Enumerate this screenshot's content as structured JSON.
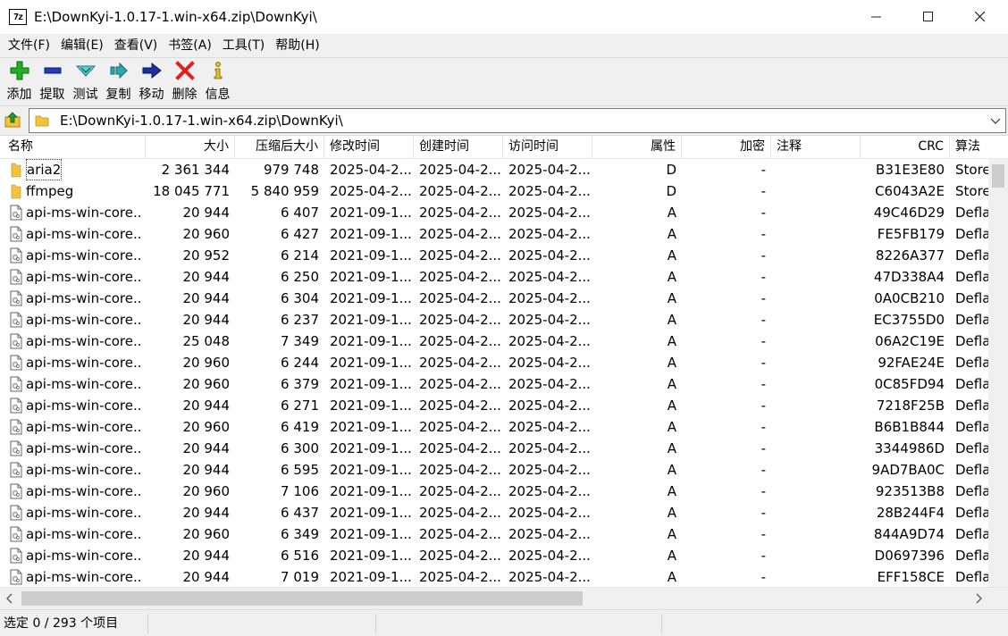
{
  "window": {
    "app_icon_text": "7z",
    "title": "E:\\DownKyi-1.0.17-1.win-x64.zip\\DownKyi\\"
  },
  "menu": [
    "文件(F)",
    "编辑(E)",
    "查看(V)",
    "书签(A)",
    "工具(T)",
    "帮助(H)"
  ],
  "toolbar": [
    {
      "label": "添加",
      "icon": "add-icon"
    },
    {
      "label": "提取",
      "icon": "extract-icon"
    },
    {
      "label": "测试",
      "icon": "test-icon"
    },
    {
      "label": "复制",
      "icon": "copy-icon"
    },
    {
      "label": "移动",
      "icon": "move-icon"
    },
    {
      "label": "删除",
      "icon": "delete-icon"
    },
    {
      "label": "信息",
      "icon": "info-icon"
    }
  ],
  "address": {
    "path": "E:\\DownKyi-1.0.17-1.win-x64.zip\\DownKyi\\"
  },
  "columns": [
    "名称",
    "大小",
    "压缩后大小",
    "修改时间",
    "创建时间",
    "访问时间",
    "属性",
    "加密",
    "注释",
    "CRC",
    "算法"
  ],
  "rows": [
    {
      "name": "aria2",
      "type": "folder",
      "size": "2 361 344",
      "packed": "979 748",
      "modified": "2025-04-2...",
      "created": "2025-04-2...",
      "accessed": "2025-04-2...",
      "attr": "D",
      "enc": "-",
      "comment": "",
      "crc": "B31E3E80",
      "method": "Store"
    },
    {
      "name": "ffmpeg",
      "type": "folder",
      "size": "18 045 771",
      "packed": "5 840 959",
      "modified": "2025-04-2...",
      "created": "2025-04-2...",
      "accessed": "2025-04-2...",
      "attr": "D",
      "enc": "-",
      "comment": "",
      "crc": "C6043A2E",
      "method": "Store"
    },
    {
      "name": "api-ms-win-core...",
      "type": "file",
      "size": "20 944",
      "packed": "6 407",
      "modified": "2021-09-1...",
      "created": "2025-04-2...",
      "accessed": "2025-04-2...",
      "attr": "A",
      "enc": "-",
      "comment": "",
      "crc": "49C46D29",
      "method": "Defla"
    },
    {
      "name": "api-ms-win-core...",
      "type": "file",
      "size": "20 960",
      "packed": "6 427",
      "modified": "2021-09-1...",
      "created": "2025-04-2...",
      "accessed": "2025-04-2...",
      "attr": "A",
      "enc": "-",
      "comment": "",
      "crc": "FE5FB179",
      "method": "Defla"
    },
    {
      "name": "api-ms-win-core...",
      "type": "file",
      "size": "20 952",
      "packed": "6 214",
      "modified": "2021-09-1...",
      "created": "2025-04-2...",
      "accessed": "2025-04-2...",
      "attr": "A",
      "enc": "-",
      "comment": "",
      "crc": "8226A377",
      "method": "Defla"
    },
    {
      "name": "api-ms-win-core...",
      "type": "file",
      "size": "20 944",
      "packed": "6 250",
      "modified": "2021-09-1...",
      "created": "2025-04-2...",
      "accessed": "2025-04-2...",
      "attr": "A",
      "enc": "-",
      "comment": "",
      "crc": "47D338A4",
      "method": "Defla"
    },
    {
      "name": "api-ms-win-core...",
      "type": "file",
      "size": "20 944",
      "packed": "6 304",
      "modified": "2021-09-1...",
      "created": "2025-04-2...",
      "accessed": "2025-04-2...",
      "attr": "A",
      "enc": "-",
      "comment": "",
      "crc": "0A0CB210",
      "method": "Defla"
    },
    {
      "name": "api-ms-win-core...",
      "type": "file",
      "size": "20 944",
      "packed": "6 237",
      "modified": "2021-09-1...",
      "created": "2025-04-2...",
      "accessed": "2025-04-2...",
      "attr": "A",
      "enc": "-",
      "comment": "",
      "crc": "EC3755D0",
      "method": "Defla"
    },
    {
      "name": "api-ms-win-core...",
      "type": "file",
      "size": "25 048",
      "packed": "7 349",
      "modified": "2021-09-1...",
      "created": "2025-04-2...",
      "accessed": "2025-04-2...",
      "attr": "A",
      "enc": "-",
      "comment": "",
      "crc": "06A2C19E",
      "method": "Defla"
    },
    {
      "name": "api-ms-win-core...",
      "type": "file",
      "size": "20 960",
      "packed": "6 244",
      "modified": "2021-09-1...",
      "created": "2025-04-2...",
      "accessed": "2025-04-2...",
      "attr": "A",
      "enc": "-",
      "comment": "",
      "crc": "92FAE24E",
      "method": "Defla"
    },
    {
      "name": "api-ms-win-core...",
      "type": "file",
      "size": "20 960",
      "packed": "6 379",
      "modified": "2021-09-1...",
      "created": "2025-04-2...",
      "accessed": "2025-04-2...",
      "attr": "A",
      "enc": "-",
      "comment": "",
      "crc": "0C85FD94",
      "method": "Defla"
    },
    {
      "name": "api-ms-win-core...",
      "type": "file",
      "size": "20 944",
      "packed": "6 271",
      "modified": "2021-09-1...",
      "created": "2025-04-2...",
      "accessed": "2025-04-2...",
      "attr": "A",
      "enc": "-",
      "comment": "",
      "crc": "7218F25B",
      "method": "Defla"
    },
    {
      "name": "api-ms-win-core...",
      "type": "file",
      "size": "20 960",
      "packed": "6 419",
      "modified": "2021-09-1...",
      "created": "2025-04-2...",
      "accessed": "2025-04-2...",
      "attr": "A",
      "enc": "-",
      "comment": "",
      "crc": "B6B1B844",
      "method": "Defla"
    },
    {
      "name": "api-ms-win-core...",
      "type": "file",
      "size": "20 944",
      "packed": "6 300",
      "modified": "2021-09-1...",
      "created": "2025-04-2...",
      "accessed": "2025-04-2...",
      "attr": "A",
      "enc": "-",
      "comment": "",
      "crc": "3344986D",
      "method": "Defla"
    },
    {
      "name": "api-ms-win-core...",
      "type": "file",
      "size": "20 944",
      "packed": "6 595",
      "modified": "2021-09-1...",
      "created": "2025-04-2...",
      "accessed": "2025-04-2...",
      "attr": "A",
      "enc": "-",
      "comment": "",
      "crc": "9AD7BA0C",
      "method": "Defla"
    },
    {
      "name": "api-ms-win-core...",
      "type": "file",
      "size": "20 960",
      "packed": "7 106",
      "modified": "2021-09-1...",
      "created": "2025-04-2...",
      "accessed": "2025-04-2...",
      "attr": "A",
      "enc": "-",
      "comment": "",
      "crc": "923513B8",
      "method": "Defla"
    },
    {
      "name": "api-ms-win-core...",
      "type": "file",
      "size": "20 944",
      "packed": "6 437",
      "modified": "2021-09-1...",
      "created": "2025-04-2...",
      "accessed": "2025-04-2...",
      "attr": "A",
      "enc": "-",
      "comment": "",
      "crc": "28B244F4",
      "method": "Defla"
    },
    {
      "name": "api-ms-win-core...",
      "type": "file",
      "size": "20 960",
      "packed": "6 349",
      "modified": "2021-09-1...",
      "created": "2025-04-2...",
      "accessed": "2025-04-2...",
      "attr": "A",
      "enc": "-",
      "comment": "",
      "crc": "844A9D74",
      "method": "Defla"
    },
    {
      "name": "api-ms-win-core...",
      "type": "file",
      "size": "20 944",
      "packed": "6 516",
      "modified": "2021-09-1...",
      "created": "2025-04-2...",
      "accessed": "2025-04-2...",
      "attr": "A",
      "enc": "-",
      "comment": "",
      "crc": "D0697396",
      "method": "Defla"
    },
    {
      "name": "api-ms-win-core...",
      "type": "file",
      "size": "20 944",
      "packed": "7 019",
      "modified": "2021-09-1...",
      "created": "2025-04-2...",
      "accessed": "2025-04-2...",
      "attr": "A",
      "enc": "-",
      "comment": "",
      "crc": "EFF158CE",
      "method": "Defla"
    }
  ],
  "status": {
    "text": "选定 0 / 293 个项目"
  },
  "colors": {
    "folder": "#f5c33b",
    "add_green": "#22b022",
    "blue": "#1b3fb8",
    "teal": "#2fa8a8",
    "red": "#e02020",
    "info_yellow": "#e8c020"
  }
}
